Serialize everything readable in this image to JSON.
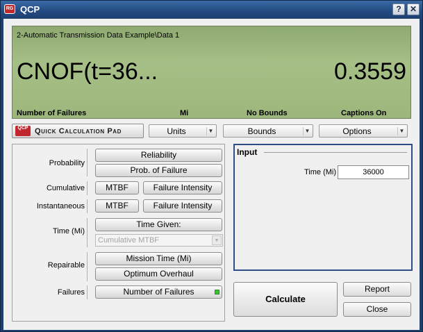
{
  "window": {
    "title": "QCP",
    "app_icon_text": "RG",
    "help_symbol": "?",
    "close_symbol": "✕"
  },
  "display": {
    "path": "2-Automatic Transmission Data Example\\Data 1",
    "function": "CNOF(t=36...",
    "value": "0.3559",
    "captions": [
      "Number of Failures",
      "Mi",
      "No Bounds",
      "Captions On"
    ]
  },
  "toolbar": {
    "qcp_logo": "QCP",
    "qcp_label": "Quick Calculation Pad",
    "units": "Units",
    "bounds": "Bounds",
    "options": "Options",
    "dropdown_arrow": "▼"
  },
  "left": {
    "probability_label": "Probability",
    "reliability": "Reliability",
    "prob_failure": "Prob. of Failure",
    "cumulative_label": "Cumulative",
    "cumulative_mtbf": "MTBF",
    "cumulative_failure_intensity": "Failure Intensity",
    "instantaneous_label": "Instantaneous",
    "instantaneous_mtbf": "MTBF",
    "instantaneous_failure_intensity": "Failure Intensity",
    "time_label": "Time (Mi)",
    "time_given": "Time Given:",
    "time_given_select": "Cumulative MTBF",
    "repairable_label": "Repairable",
    "mission_time": "Mission Time (Mi)",
    "optimum_overhaul": "Optimum Overhaul",
    "failures_label": "Failures",
    "number_of_failures": "Number of Failures"
  },
  "input": {
    "title": "Input",
    "time_label": "Time (Mi)",
    "time_value": "36000"
  },
  "actions": {
    "calculate": "Calculate",
    "report": "Report",
    "close": "Close"
  }
}
